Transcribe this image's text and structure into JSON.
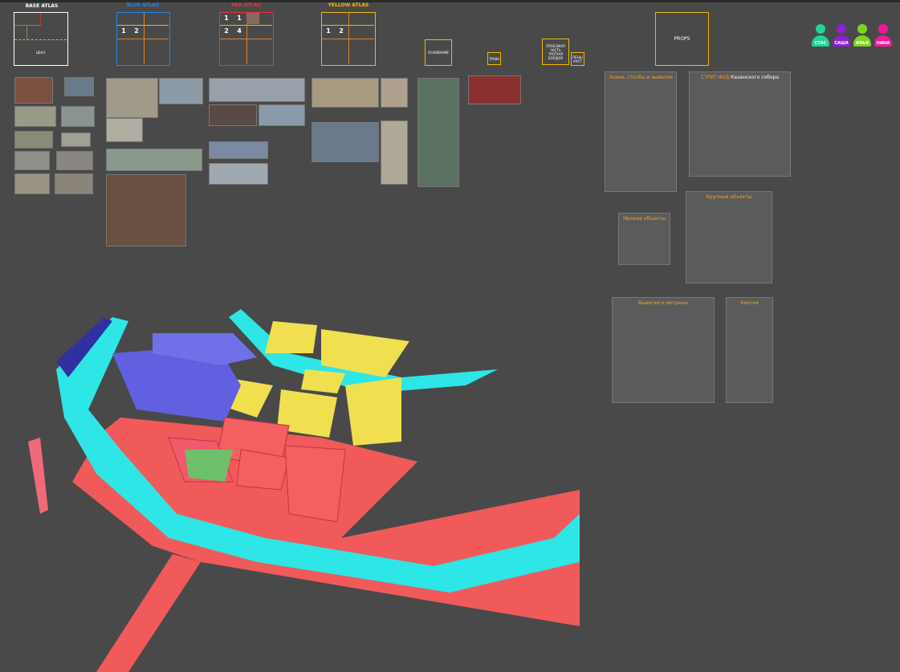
{
  "atlases": [
    {
      "title": "BASE ATLAS",
      "color": "#ffffff",
      "cells": [
        "",
        "",
        "",
        "",
        "",
        "ЦЕНЗ"
      ]
    },
    {
      "title": "BLUE ATLAS",
      "color": "#1e88e5",
      "nums": [
        "1",
        "2"
      ]
    },
    {
      "title": "RED ATLAS",
      "color": "#e53935",
      "nums": [
        "1",
        "1",
        "2",
        "4"
      ]
    },
    {
      "title": "YELLOW ATLAS",
      "color": "#f5b800",
      "nums": [
        "1",
        "2"
      ]
    }
  ],
  "small_boxes": [
    "ОСНОВАНИЕ",
    "ТРАВА",
    "ПРОЕЗЖАЯ ЧАСТЬ ТРОТУАР БОРДЮР",
    "ПЕНЬ/ КУСТ"
  ],
  "props_label": "PROPS",
  "users": [
    {
      "name": "СТАС",
      "color": "#1fd39a"
    },
    {
      "name": "САША",
      "color": "#8a1fd6"
    },
    {
      "name": "ИЛЬЯ",
      "color": "#7ed321"
    },
    {
      "name": "НИНА",
      "color": "#f0189a"
    }
  ],
  "panels": {
    "signs": "Знаки, столбы и вывески",
    "streetfood_accent": "СТРИТ-ФУД",
    "streetfood": "Казанского собора",
    "small": "Мелкие объекты",
    "large": "Крупные объекты",
    "signboards": "Вывески и витрины",
    "kiosks": "Киоски"
  }
}
